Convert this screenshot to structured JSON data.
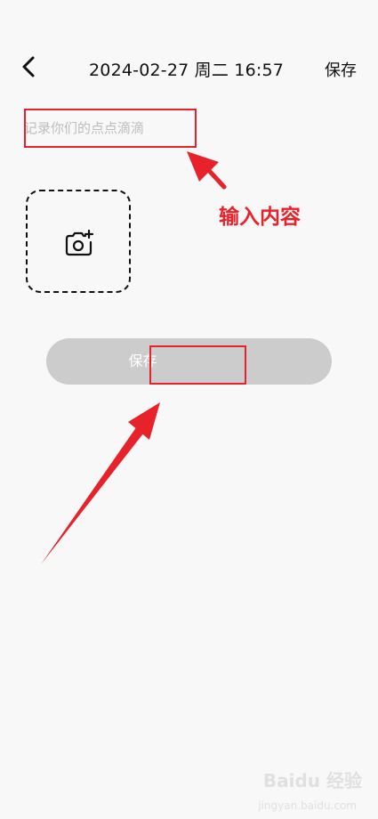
{
  "header": {
    "datetime": "2024-02-27 周二 16:57",
    "save_label": "保存"
  },
  "editor": {
    "placeholder": "记录你们的点点滴滴",
    "value": ""
  },
  "main": {
    "save_button_label": "保存"
  },
  "annotation": {
    "label": "输入内容",
    "color": "#e8222b"
  },
  "watermark": {
    "text": "Baidu 经验",
    "sub": "jingyan.baidu.com"
  },
  "icons": {
    "back": "chevron-left-icon",
    "photo": "camera-plus-icon"
  }
}
